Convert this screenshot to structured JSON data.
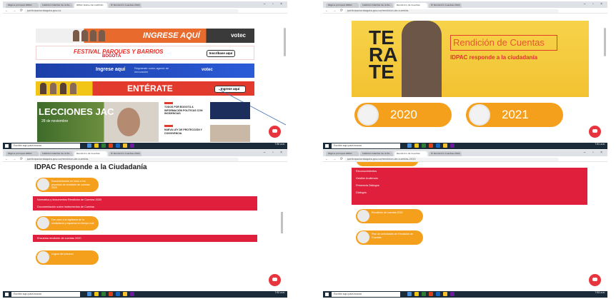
{
  "panels": [
    {
      "tabs": [
        "Página principal IDPAC",
        "Instituto Distrital de la Pa...",
        "IDPAC Datos del Instituto",
        "IF. Rendición Cuentas 2020"
      ],
      "url": "participacionbogota.gov.co",
      "banners": {
        "ingrese": "INGRESE AQUÍ",
        "ingrese_logo": "votec",
        "festival": "FESTIVAL PARQUES Y BARRIOS",
        "festival_sub": "BOGOTÁ",
        "festival_btn": "Inscríbase aquí",
        "ingrese2": "Ingrese aquí",
        "ingrese2_sub": "Regístrate como agente de innovación",
        "votec2": "votec",
        "enterate": "ENTÉRATE",
        "enterate_btn": "Ingrese aquí"
      },
      "lecciones": {
        "title": "LECCIONES JAC",
        "date": "28 de noviembre"
      },
      "news": [
        {
          "title": "TODOS POR BOGOTÁ A INFORMACIÓN POLÍTICAS CON INCIDENCIAS"
        },
        {
          "title": "NUEVA LEY DE PROTECCIÓN Y CONVIVENCIA"
        }
      ],
      "search": "Escribe aquí para buscar",
      "clock": "7:50 a.m."
    },
    {
      "tabs": [
        "Página principal IDPAC",
        "Instituto Distrital de la Pa...",
        "Rendición de Cuentas",
        "IF. Rendición Cuentas 2020"
      ],
      "url": "participacionbogota.gov.co/rendicion-de-cuentas",
      "hero_letters": "TE\nRA\nTE",
      "title": "Rendición de Cuentas",
      "subtitle": "IDPAC responde a la ciudadanía",
      "years": [
        "2020",
        "2021"
      ],
      "search": "Escribe aquí para buscar",
      "clock": "7:51 a.m."
    },
    {
      "tabs": [
        "Página principal IDPAC",
        "Instituto Distrital de la Pa...",
        "Rendición de Cuentas",
        "IF. Rendición Cuentas 2020"
      ],
      "url": "participacionbogota.gov.co/rendicion-de-cuentas",
      "heading": "IDPAC Responde a la Ciudadanía",
      "pill1": "Documentación en torno a los procesos de rendición de cuentas 2020",
      "red_items_1": [
        "Normativa y documentos Rendición de Cuentas 2020",
        "Documentación sobre instrumentos de Cuentas"
      ],
      "pill2": "Dar paso a la vigilancia de la ciudadanía y espacios en tiempo real",
      "red_items_2": [
        "Encuesta rendición de cuentas 2020"
      ],
      "pill3": "Logros del proceso",
      "search": "Escribe aquí para buscar",
      "clock": "7:52 a.m."
    },
    {
      "tabs": [
        "Página principal IDPAC",
        "Instituto Distrital de la Pa...",
        "Rendición de Cuentas",
        "IF. Rendición Cuentas 2020"
      ],
      "url": "participacionbogota.gov.co/rendicion-de-cuentas-2020",
      "red_items": [
        "Reconocimientos",
        "Gestión Audiencia",
        "Presencia Diálogos",
        "Diálogos"
      ],
      "pill1": "Rendición de cuentas 2020",
      "pill2": "Plan de actividades de Rendición de Cuentas",
      "search": "Escribe aquí para buscar",
      "clock": "7:53 a.m."
    }
  ],
  "colors": {
    "orange": "#f5a01c",
    "red": "#e01f3d",
    "yellow": "#f2c232",
    "taskbar": "#1c2b3a"
  }
}
